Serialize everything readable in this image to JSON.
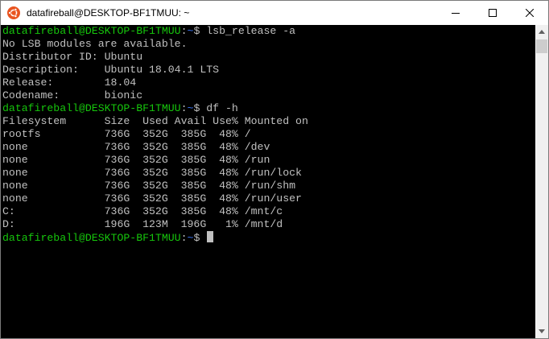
{
  "window": {
    "title": "datafireball@DESKTOP-BF1TMUU: ~",
    "app_icon": "ubuntu-logo-icon",
    "controls": [
      "minimize-icon",
      "maximize-icon",
      "close-icon"
    ]
  },
  "prompt": {
    "user_host": "datafireball@DESKTOP-BF1TMUU",
    "separator": ":",
    "path": "~",
    "symbol": "$ "
  },
  "terminal": {
    "lines": [
      {
        "type": "prompt",
        "command": "lsb_release -a"
      },
      {
        "type": "output",
        "text": "No LSB modules are available."
      },
      {
        "type": "output",
        "text": "Distributor ID: Ubuntu"
      },
      {
        "type": "output",
        "text": "Description:    Ubuntu 18.04.1 LTS"
      },
      {
        "type": "output",
        "text": "Release:        18.04"
      },
      {
        "type": "output",
        "text": "Codename:       bionic"
      },
      {
        "type": "prompt",
        "command": "df -h"
      },
      {
        "type": "output",
        "text": "Filesystem      Size  Used Avail Use% Mounted on"
      },
      {
        "type": "output",
        "text": "rootfs          736G  352G  385G  48% /"
      },
      {
        "type": "output",
        "text": "none            736G  352G  385G  48% /dev"
      },
      {
        "type": "output",
        "text": "none            736G  352G  385G  48% /run"
      },
      {
        "type": "output",
        "text": "none            736G  352G  385G  48% /run/lock"
      },
      {
        "type": "output",
        "text": "none            736G  352G  385G  48% /run/shm"
      },
      {
        "type": "output",
        "text": "none            736G  352G  385G  48% /run/user"
      },
      {
        "type": "output",
        "text": "C:              736G  352G  385G  48% /mnt/c"
      },
      {
        "type": "output",
        "text": "D:              196G  123M  196G   1% /mnt/d"
      },
      {
        "type": "prompt",
        "command": "",
        "cursor": true
      }
    ]
  },
  "colors": {
    "background": "#000000",
    "text": "#c0c0c0",
    "prompt_user": "#16c60c",
    "prompt_path": "#3b78ff",
    "titlebar": "#ffffff"
  }
}
